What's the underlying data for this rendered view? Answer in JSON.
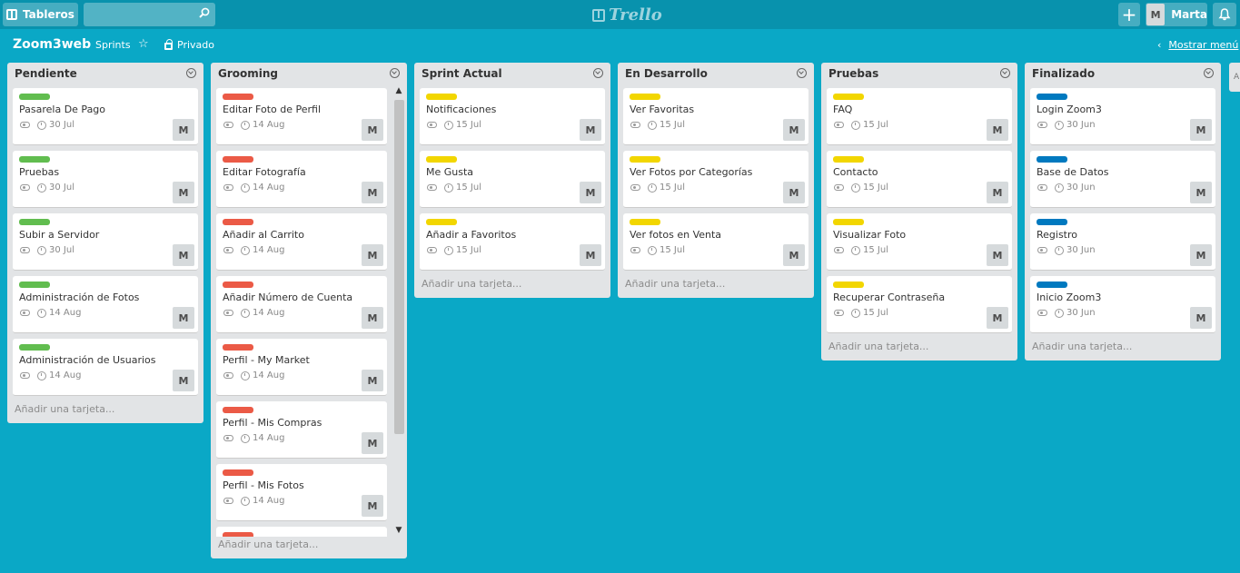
{
  "topbar": {
    "boards_label": "Tableros",
    "search_value": "",
    "logo_text": "Trello",
    "add_symbol": "+",
    "user_initial": "M",
    "user_name": "Marta"
  },
  "board": {
    "title": "Zoom3web",
    "team": "Sprints",
    "privacy": "Privado",
    "show_menu": "Mostrar menú"
  },
  "colors": {
    "green": "#61bd4f",
    "red": "#eb5a46",
    "yellow": "#f2d600",
    "blue": "#0079bf"
  },
  "add_card_label": "Añadir una tarjeta...",
  "lists": [
    {
      "title": "Pendiente",
      "cards": [
        {
          "title": "Pasarela De Pago",
          "label": "green",
          "due": "30 Jul",
          "member": "M"
        },
        {
          "title": "Pruebas",
          "label": "green",
          "due": "30 Jul",
          "member": "M"
        },
        {
          "title": "Subir a Servidor",
          "label": "green",
          "due": "30 Jul",
          "member": "M"
        },
        {
          "title": "Administración de Fotos",
          "label": "green",
          "due": "14 Aug",
          "member": "M"
        },
        {
          "title": "Administración de Usuarios",
          "label": "green",
          "due": "14 Aug",
          "member": "M"
        }
      ]
    },
    {
      "title": "Grooming",
      "scroll": true,
      "cards": [
        {
          "title": "Editar Foto de Perfil",
          "label": "red",
          "due": "14 Aug",
          "member": "M"
        },
        {
          "title": "Editar Fotografía",
          "label": "red",
          "due": "14 Aug",
          "member": "M"
        },
        {
          "title": "Añadir al Carrito",
          "label": "red",
          "due": "14 Aug",
          "member": "M"
        },
        {
          "title": "Añadir Número de Cuenta",
          "label": "red",
          "due": "14 Aug",
          "member": "M"
        },
        {
          "title": "Perfil - My Market",
          "label": "red",
          "due": "14 Aug",
          "member": "M"
        },
        {
          "title": "Perfil - Mis Compras",
          "label": "red",
          "due": "14 Aug",
          "member": "M"
        },
        {
          "title": "Perfil - Mis Fotos",
          "label": "red",
          "due": "14 Aug",
          "member": "M"
        },
        {
          "title": "",
          "label": "red",
          "due": "",
          "member": ""
        }
      ]
    },
    {
      "title": "Sprint Actual",
      "cards": [
        {
          "title": "Notificaciones",
          "label": "yellow",
          "due": "15 Jul",
          "member": "M"
        },
        {
          "title": "Me Gusta",
          "label": "yellow",
          "due": "15 Jul",
          "member": "M"
        },
        {
          "title": "Añadir a Favoritos",
          "label": "yellow",
          "due": "15 Jul",
          "member": "M"
        }
      ]
    },
    {
      "title": "En Desarrollo",
      "cards": [
        {
          "title": "Ver Favoritas",
          "label": "yellow",
          "due": "15 Jul",
          "member": "M"
        },
        {
          "title": "Ver Fotos por Categorías",
          "label": "yellow",
          "due": "15 Jul",
          "member": "M"
        },
        {
          "title": "Ver fotos en Venta",
          "label": "yellow",
          "due": "15 Jul",
          "member": "M"
        }
      ]
    },
    {
      "title": "Pruebas",
      "cards": [
        {
          "title": "FAQ",
          "label": "yellow",
          "due": "15 Jul",
          "member": "M"
        },
        {
          "title": "Contacto",
          "label": "yellow",
          "due": "15 Jul",
          "member": "M"
        },
        {
          "title": "Visualizar Foto",
          "label": "yellow",
          "due": "15 Jul",
          "member": "M"
        },
        {
          "title": "Recuperar Contraseña",
          "label": "yellow",
          "due": "15 Jul",
          "member": "M"
        }
      ]
    },
    {
      "title": "Finalizado",
      "cards": [
        {
          "title": "Login Zoom3",
          "label": "blue",
          "due": "30 Jun",
          "member": "M"
        },
        {
          "title": "Base de Datos",
          "label": "blue",
          "due": "30 Jun",
          "member": "M"
        },
        {
          "title": "Registro",
          "label": "blue",
          "due": "30 Jun",
          "member": "M"
        },
        {
          "title": "Inicio Zoom3",
          "label": "blue",
          "due": "30 Jun",
          "member": "M"
        }
      ]
    }
  ]
}
